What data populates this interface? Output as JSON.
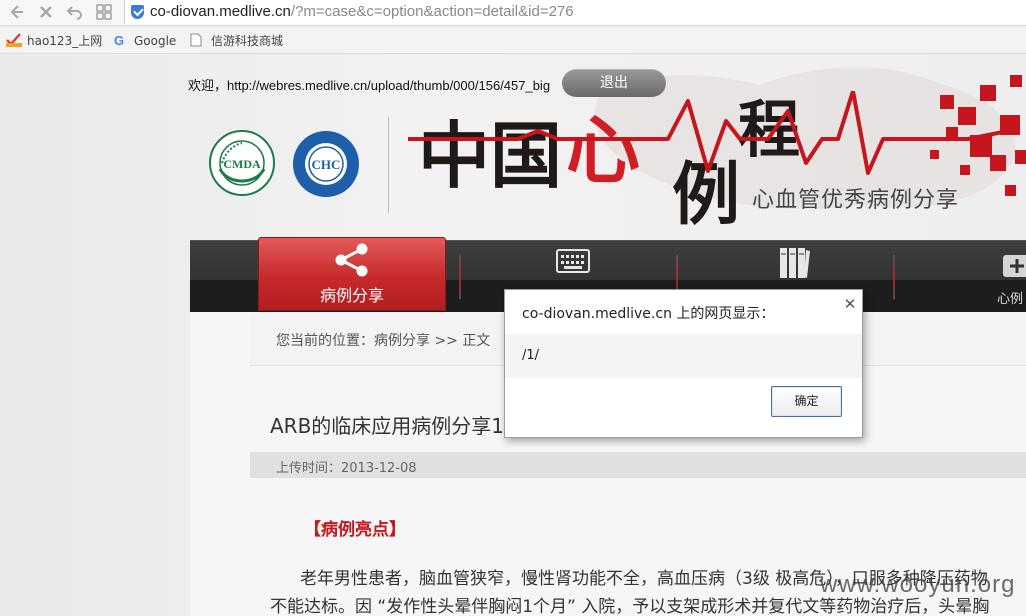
{
  "browser": {
    "url_host": "co-diovan.medlive.cn",
    "url_rest": "/?m=case&c=option&action=detail&id=276",
    "bookmarks": [
      {
        "label": "hao123_上网"
      },
      {
        "label": "Google"
      },
      {
        "label": "信游科技商城"
      }
    ]
  },
  "header": {
    "welcome": "欢迎，http://webres.medlive.cn/upload/thumb/000/156/457_big",
    "logout_label": "退出",
    "logo_cmda_text": "CMDA",
    "logo_chc_text": "CHC",
    "title_chars": [
      "中国",
      "心",
      "例",
      "程"
    ],
    "subtitle": "心血管优秀病例分享"
  },
  "nav": {
    "active_label": "病例分享",
    "right_label": "心例"
  },
  "content": {
    "breadcrumb": "您当前的位置：病例分享 >> 正文",
    "article_title": "ARB的临床应用病例分享1",
    "upload_time": "上传时间：2013-12-08",
    "highlight": "【病例亮点】",
    "para1": "老年男性患者，脑血管狭窄，慢性肾功能不全，高血压病（3级  极高危），口服多种降压药物",
    "para2": "不能达标。因 “发作性头晕伴胸闷1个月” 入院，予以支架成形术并复代文等药物治疗后，头晕胸"
  },
  "dialog": {
    "title": "co-diovan.medlive.cn 上的网页显示：",
    "message": "/1/",
    "ok_label": "确定"
  },
  "watermark": "www.wooyun.org",
  "colors": {
    "accent_red": "#c72a2a",
    "navbar_dark": "#2a2a2a",
    "highlight_red": "#c8161d"
  }
}
